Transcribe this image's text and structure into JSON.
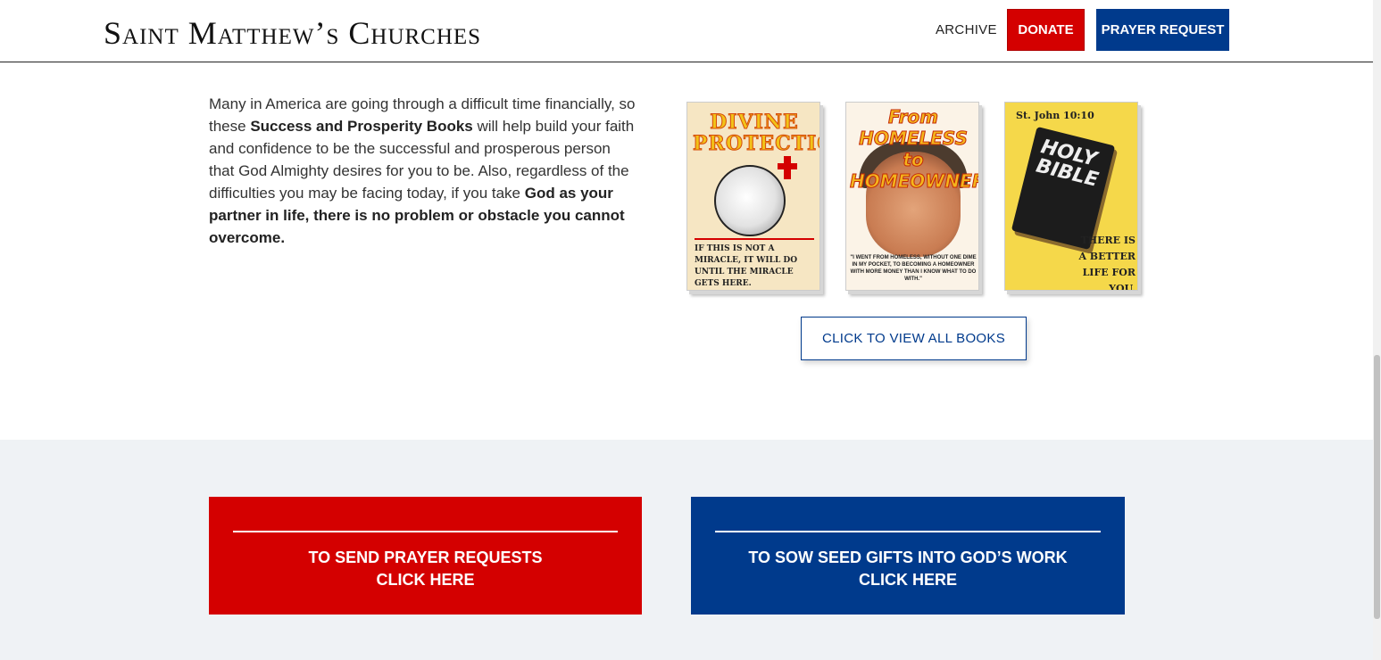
{
  "header": {
    "logo": "Saint Matthew’s Churches",
    "nav": {
      "archive": "ARCHIVE",
      "donate": "DONATE",
      "prayer_request": "PRAYER REQUEST"
    }
  },
  "intro": {
    "t1": "Many in America are going through a difficult time financially, so these ",
    "b1": "Success and Prosperity Books",
    "t2": " will help build your faith and confidence to be the successful and prosperous person that God Almighty desires for you to be. Also, regardless of the difficulties you may be facing today, if you take ",
    "b2": "God as your partner in life, there is no problem or obstacle you cannot overcome."
  },
  "books": [
    {
      "title": "DIVINE PROTECTION",
      "caption": "IF THIS IS NOT A MIRACLE, IT WILL DO UNTIL THE MIRACLE GETS HERE."
    },
    {
      "title": "From HOMELESS to HOMEOWNER",
      "caption": "\"I WENT FROM HOMELESS, WITHOUT ONE DIME IN MY POCKET, TO BECOMING A HOMEOWNER WITH MORE MONEY THAN I KNOW WHAT TO DO WITH.\""
    },
    {
      "reference": "St. John 10:10",
      "title": "HOLY BIBLE",
      "caption": "THERE IS A BETTER LIFE FOR YOU."
    }
  ],
  "view_all_button": "CLICK TO VIEW ALL BOOKS",
  "cta": {
    "prayer": {
      "line1": "TO SEND PRAYER REQUESTS",
      "line2": "CLICK HERE"
    },
    "seed": {
      "line1": "TO SOW SEED GIFTS INTO GOD’S WORK",
      "line2": "CLICK HERE"
    }
  },
  "colors": {
    "red": "#d40000",
    "blue": "#003a8c",
    "band": "#eff2f5"
  }
}
